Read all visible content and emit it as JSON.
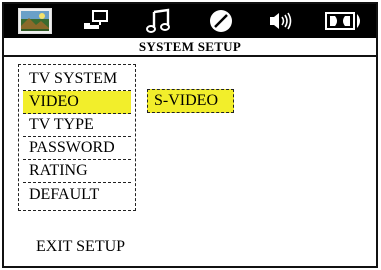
{
  "icons": [
    {
      "name": "picture-tab-icon"
    },
    {
      "name": "settings-tab-icon"
    },
    {
      "name": "music-tab-icon"
    },
    {
      "name": "disc-tab-icon"
    },
    {
      "name": "speaker-tab-icon"
    },
    {
      "name": "dolby-tab-icon"
    }
  ],
  "title": "SYSTEM SETUP",
  "menu": {
    "items": [
      {
        "label": "TV SYSTEM"
      },
      {
        "label": "VIDEO"
      },
      {
        "label": "TV TYPE"
      },
      {
        "label": "PASSWORD"
      },
      {
        "label": "RATING"
      },
      {
        "label": "DEFAULT"
      }
    ],
    "selected_index": 1
  },
  "submenu": {
    "value": "S-VIDEO"
  },
  "exit_label": "EXIT SETUP",
  "colors": {
    "highlight": "#f2ee2b",
    "iconbar": "#000000"
  }
}
